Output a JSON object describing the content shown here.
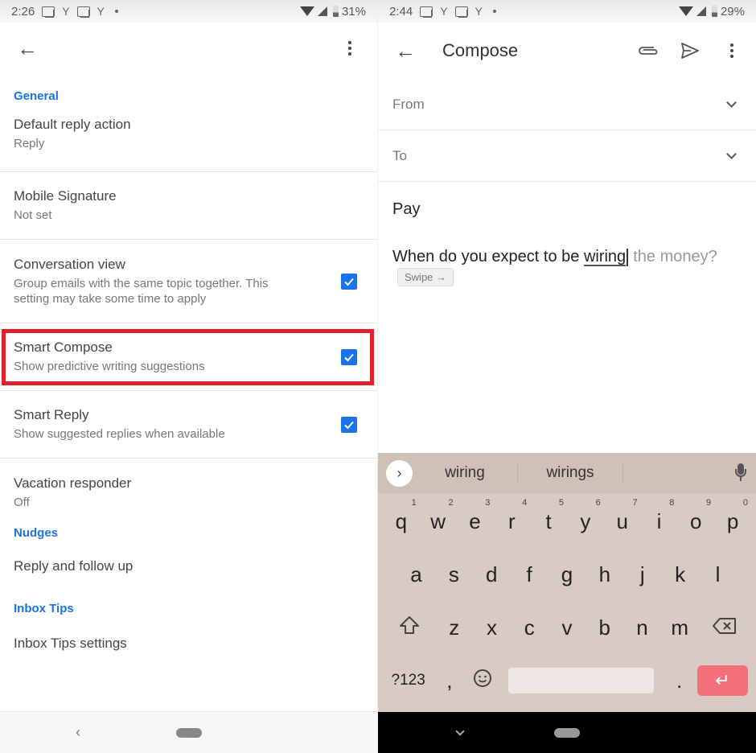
{
  "left": {
    "status_bar": {
      "time": "2:26",
      "notif_y1": "Y",
      "notif_y2": "Y",
      "battery": "31%"
    },
    "appbar": {
      "back_icon": "arrow-back-icon",
      "menu_icon": "more-vert-icon"
    },
    "sections": [
      {
        "header": "General"
      },
      {
        "header": "Nudges"
      },
      {
        "header": "Inbox Tips"
      }
    ],
    "settings": {
      "default_reply": {
        "title": "Default reply action",
        "sub": "Reply"
      },
      "signature": {
        "title": "Mobile Signature",
        "sub": "Not set"
      },
      "conversation": {
        "title": "Conversation view",
        "sub": "Group emails with the same topic together. This setting may take some time to apply",
        "checked": true
      },
      "smart_compose": {
        "title": "Smart Compose",
        "sub": "Show predictive writing suggestions",
        "checked": true,
        "highlighted": true
      },
      "smart_reply": {
        "title": "Smart Reply",
        "sub": "Show suggested replies when available",
        "checked": true
      },
      "vacation": {
        "title": "Vacation responder",
        "sub": "Off"
      },
      "reply_follow": {
        "title": "Reply and follow up"
      },
      "inbox_tips": {
        "title": "Inbox Tips settings"
      }
    },
    "highlight_color": "#e0202a",
    "accent_color": "#1a73e8"
  },
  "right": {
    "status_bar": {
      "time": "2:44",
      "notif_y1": "Y",
      "notif_y2": "Y",
      "battery": "29%"
    },
    "appbar": {
      "title": "Compose",
      "attach_icon": "paperclip-icon",
      "send_icon": "send-icon",
      "menu_icon": "more-vert-icon"
    },
    "fields": {
      "from_label": "From",
      "to_label": "To",
      "subject": "Pay"
    },
    "body": {
      "typed": "When do you expect to be ",
      "current_word": "wiring",
      "suggestion": " the money?",
      "chip": "Swipe →"
    },
    "keyboard": {
      "suggestions": [
        "wiring",
        "wirings"
      ],
      "row1": [
        {
          "k": "q",
          "n": "1"
        },
        {
          "k": "w",
          "n": "2"
        },
        {
          "k": "e",
          "n": "3"
        },
        {
          "k": "r",
          "n": "4"
        },
        {
          "k": "t",
          "n": "5"
        },
        {
          "k": "y",
          "n": "6"
        },
        {
          "k": "u",
          "n": "7"
        },
        {
          "k": "i",
          "n": "8"
        },
        {
          "k": "o",
          "n": "9"
        },
        {
          "k": "p",
          "n": "0"
        }
      ],
      "row2": [
        "a",
        "s",
        "d",
        "f",
        "g",
        "h",
        "j",
        "k",
        "l"
      ],
      "row3": [
        "z",
        "x",
        "c",
        "v",
        "b",
        "n",
        "m"
      ],
      "symbols_key": "?123",
      "comma_key": ",",
      "period_key": ".",
      "enter_color": "#f2707a"
    }
  }
}
